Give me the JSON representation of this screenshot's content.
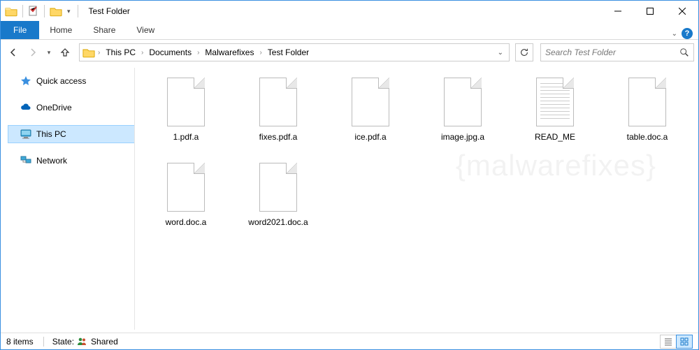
{
  "title": "Test Folder",
  "ribbon": {
    "file": "File",
    "tabs": [
      "Home",
      "Share",
      "View"
    ]
  },
  "breadcrumb": [
    "This PC",
    "Documents",
    "Malwarefixes",
    "Test Folder"
  ],
  "search": {
    "placeholder": "Search Test Folder"
  },
  "sidebar": {
    "items": [
      {
        "label": "Quick access",
        "icon": "star"
      },
      {
        "label": "OneDrive",
        "icon": "cloud"
      },
      {
        "label": "This PC",
        "icon": "monitor",
        "selected": true
      },
      {
        "label": "Network",
        "icon": "network"
      }
    ]
  },
  "files": [
    {
      "name": "1.pdf.a",
      "type": "blank"
    },
    {
      "name": "fixes.pdf.a",
      "type": "blank"
    },
    {
      "name": "ice.pdf.a",
      "type": "blank"
    },
    {
      "name": "image.jpg.a",
      "type": "blank"
    },
    {
      "name": "READ_ME",
      "type": "readme"
    },
    {
      "name": "table.doc.a",
      "type": "blank"
    },
    {
      "name": "word.doc.a",
      "type": "blank"
    },
    {
      "name": "word2021.doc.a",
      "type": "blank"
    }
  ],
  "status": {
    "count_label": "8 items",
    "state_label": "State:",
    "state_value": "Shared"
  },
  "watermark": "{malwarefixes}"
}
